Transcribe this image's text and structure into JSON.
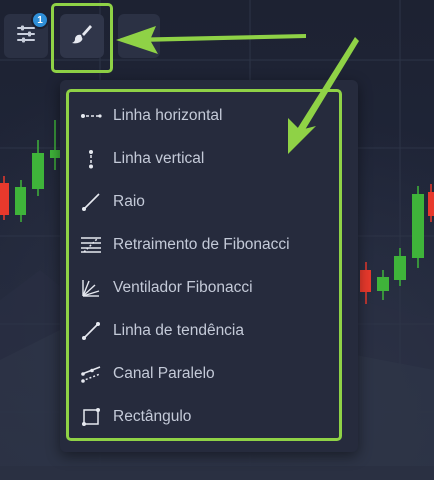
{
  "toolbar": {
    "settings_icon": "sliders-icon",
    "badge_count": "1",
    "brush_icon": "brush-icon",
    "more_icon": "line-tool-icon"
  },
  "menu": {
    "items": [
      {
        "label": "Linha horizontal",
        "icon": "horizontal-line-icon"
      },
      {
        "label": "Linha vertical",
        "icon": "vertical-line-icon"
      },
      {
        "label": "Raio",
        "icon": "ray-icon"
      },
      {
        "label": "Retraimento de Fibonacci",
        "icon": "fibonacci-retracement-icon"
      },
      {
        "label": "Ventilador Fibonacci",
        "icon": "fibonacci-fan-icon"
      },
      {
        "label": "Linha de tendência",
        "icon": "trend-line-icon"
      },
      {
        "label": "Canal Paralelo",
        "icon": "parallel-channel-icon"
      },
      {
        "label": "Rectângulo",
        "icon": "rectangle-icon"
      }
    ]
  },
  "colors": {
    "highlight": "#8fd246",
    "candle_up": "#3fb43a",
    "candle_down": "#e8392c",
    "badge": "#2f8fd8"
  }
}
